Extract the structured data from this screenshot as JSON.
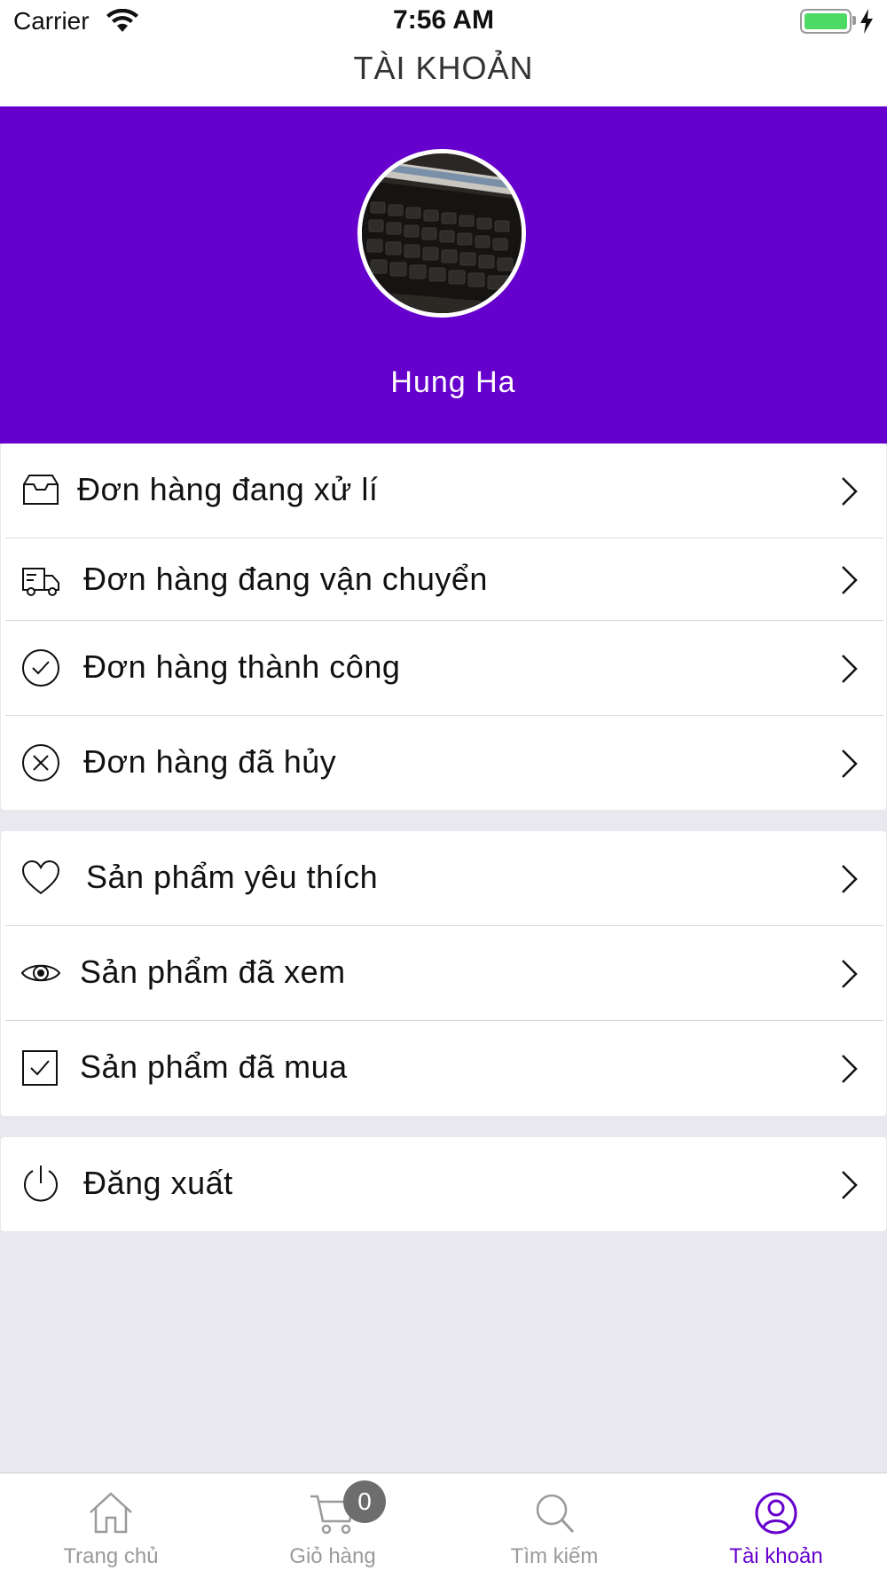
{
  "status_bar": {
    "carrier": "Carrier",
    "time": "7:56 AM"
  },
  "header": {
    "title": "TÀI KHOẢN"
  },
  "profile": {
    "name": "Hung Ha",
    "background": "#6600cc"
  },
  "orders": [
    {
      "label": "Đơn hàng đang xử lí",
      "icon": "inbox-icon"
    },
    {
      "label": "Đơn hàng đang vận chuyển",
      "icon": "truck-icon"
    },
    {
      "label": "Đơn hàng thành công",
      "icon": "check-circle-icon"
    },
    {
      "label": "Đơn hàng đã hủy",
      "icon": "x-circle-icon"
    }
  ],
  "products": [
    {
      "label": "Sản phẩm yêu thích",
      "icon": "heart-icon"
    },
    {
      "label": "Sản phẩm đã xem",
      "icon": "eye-icon"
    },
    {
      "label": "Sản phẩm đã mua",
      "icon": "checkbox-icon"
    }
  ],
  "account": [
    {
      "label": "Đăng xuất",
      "icon": "power-icon"
    }
  ],
  "tabbar": {
    "tabs": [
      {
        "label": "Trang chủ",
        "icon": "home-icon",
        "active": false
      },
      {
        "label": "Giỏ hàng",
        "icon": "cart-icon",
        "active": false
      },
      {
        "label": "Tìm kiếm",
        "icon": "search-icon",
        "active": false
      },
      {
        "label": "Tài khoản",
        "icon": "user-icon",
        "active": true
      }
    ],
    "cart_badge": "0",
    "active_color": "#6600cc"
  }
}
